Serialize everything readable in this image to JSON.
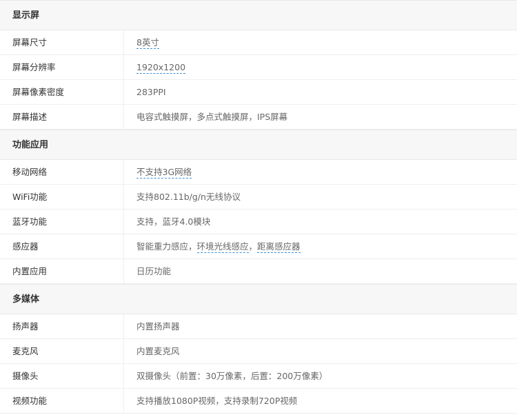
{
  "sections": [
    {
      "title": "显示屏",
      "rows": [
        {
          "label": "屏幕尺寸",
          "segments": [
            {
              "text": "8英寸",
              "link": true
            }
          ]
        },
        {
          "label": "屏幕分辨率",
          "segments": [
            {
              "text": "1920x1200",
              "link": true
            }
          ]
        },
        {
          "label": "屏幕像素密度",
          "segments": [
            {
              "text": "283PPI",
              "link": false
            }
          ]
        },
        {
          "label": "屏幕描述",
          "segments": [
            {
              "text": "电容式触摸屏，多点式触摸屏，IPS屏幕",
              "link": false
            }
          ]
        }
      ]
    },
    {
      "title": "功能应用",
      "rows": [
        {
          "label": "移动网络",
          "segments": [
            {
              "text": "不支持3G网络",
              "link": true
            }
          ]
        },
        {
          "label": "WiFi功能",
          "segments": [
            {
              "text": "支持802.11b/g/n无线协议",
              "link": false
            }
          ]
        },
        {
          "label": "蓝牙功能",
          "segments": [
            {
              "text": "支持，蓝牙4.0模块",
              "link": false
            }
          ]
        },
        {
          "label": "感应器",
          "segments": [
            {
              "text": "智能重力感应，",
              "link": false
            },
            {
              "text": "环境光线感应",
              "link": true
            },
            {
              "text": "，",
              "link": false
            },
            {
              "text": "距离感应器",
              "link": true
            }
          ]
        },
        {
          "label": "内置应用",
          "segments": [
            {
              "text": "日历功能",
              "link": false
            }
          ]
        }
      ]
    },
    {
      "title": "多媒体",
      "rows": [
        {
          "label": "扬声器",
          "segments": [
            {
              "text": "内置扬声器",
              "link": false
            }
          ]
        },
        {
          "label": "麦克风",
          "segments": [
            {
              "text": "内置麦克风",
              "link": false
            }
          ]
        },
        {
          "label": "摄像头",
          "segments": [
            {
              "text": "双摄像头（前置：30万像素，后置：200万像素）",
              "link": false
            }
          ]
        },
        {
          "label": "视频功能",
          "segments": [
            {
              "text": "支持播放1080P视频，支持录制720P视频",
              "link": false
            }
          ]
        }
      ]
    }
  ],
  "colors": {
    "header_bg": "#f7f7f7",
    "label_text": "#333333",
    "value_text": "#666666",
    "link_underline": "#3d8fd8"
  }
}
